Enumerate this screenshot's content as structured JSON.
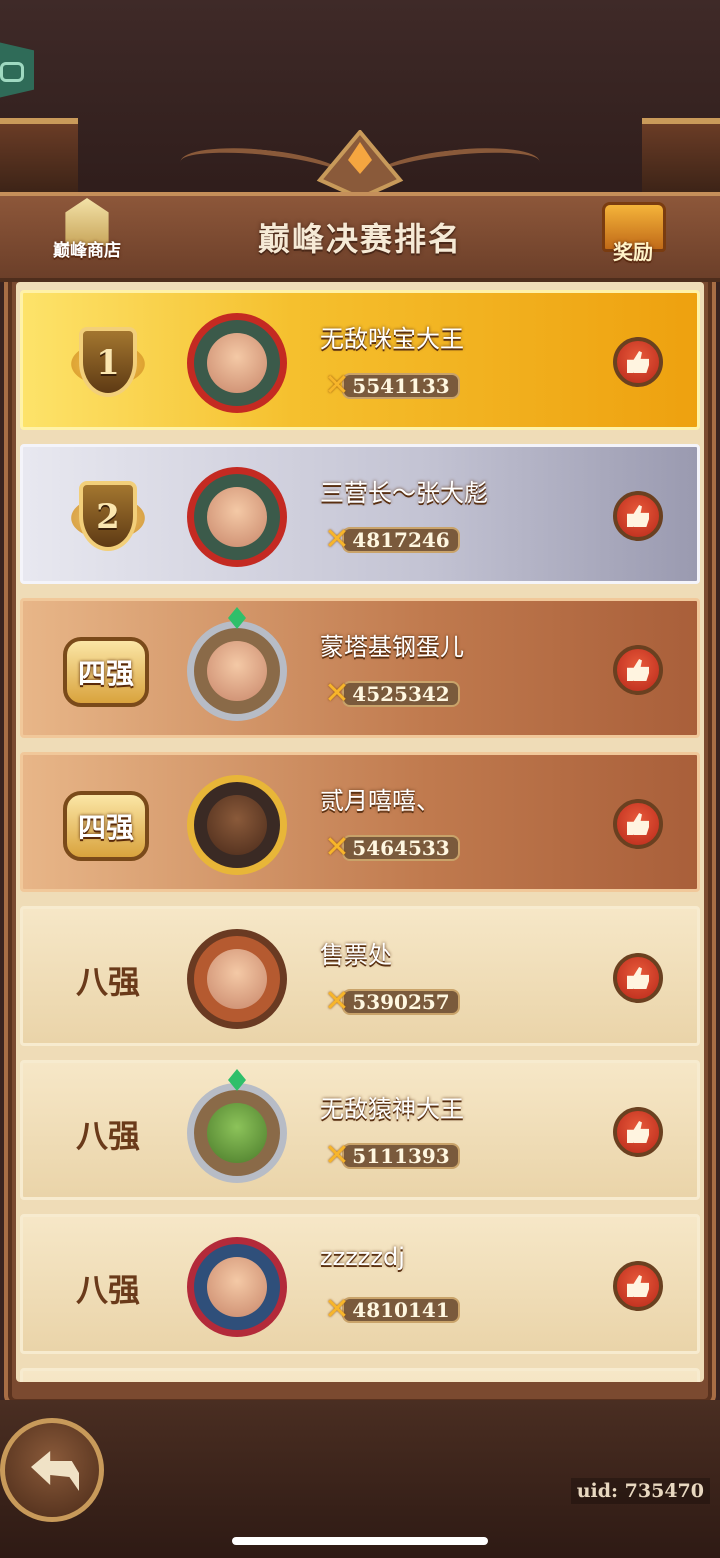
{
  "header": {
    "title": "巅峰决赛排名",
    "shop_label": "巅峰商店",
    "reward_label": "奖励"
  },
  "players": [
    {
      "rank": "1",
      "name": "无敌咪宝大王",
      "score": "5541133"
    },
    {
      "rank": "2",
      "name": "三营长～张大彪",
      "score": "4817246"
    },
    {
      "rank": "四强",
      "name": "蒙塔基钢蛋儿",
      "score": "4525342"
    },
    {
      "rank": "四强",
      "name": "贰月嘻嘻、",
      "score": "5464533"
    },
    {
      "rank": "八强",
      "name": "售票处",
      "score": "5390257"
    },
    {
      "rank": "八强",
      "name": "无敌猿神大王",
      "score": "5111393"
    },
    {
      "rank": "八强",
      "name": "zzzzzdj",
      "score": "4810141"
    }
  ],
  "footer": {
    "uid": "uid: 735470"
  },
  "icons": {
    "shop": "gift-box-icon",
    "reward": "treasure-chest-icon",
    "score": "crossed-swords-icon",
    "like": "thumbs-up-icon",
    "back": "back-arrow-icon",
    "corner": "gamepad-icon"
  },
  "colors": {
    "gold_row": "#f5c02e",
    "silver_row": "#c3c3d3",
    "bronze_row": "#c07a4e",
    "plain_row": "#efdcb7"
  }
}
